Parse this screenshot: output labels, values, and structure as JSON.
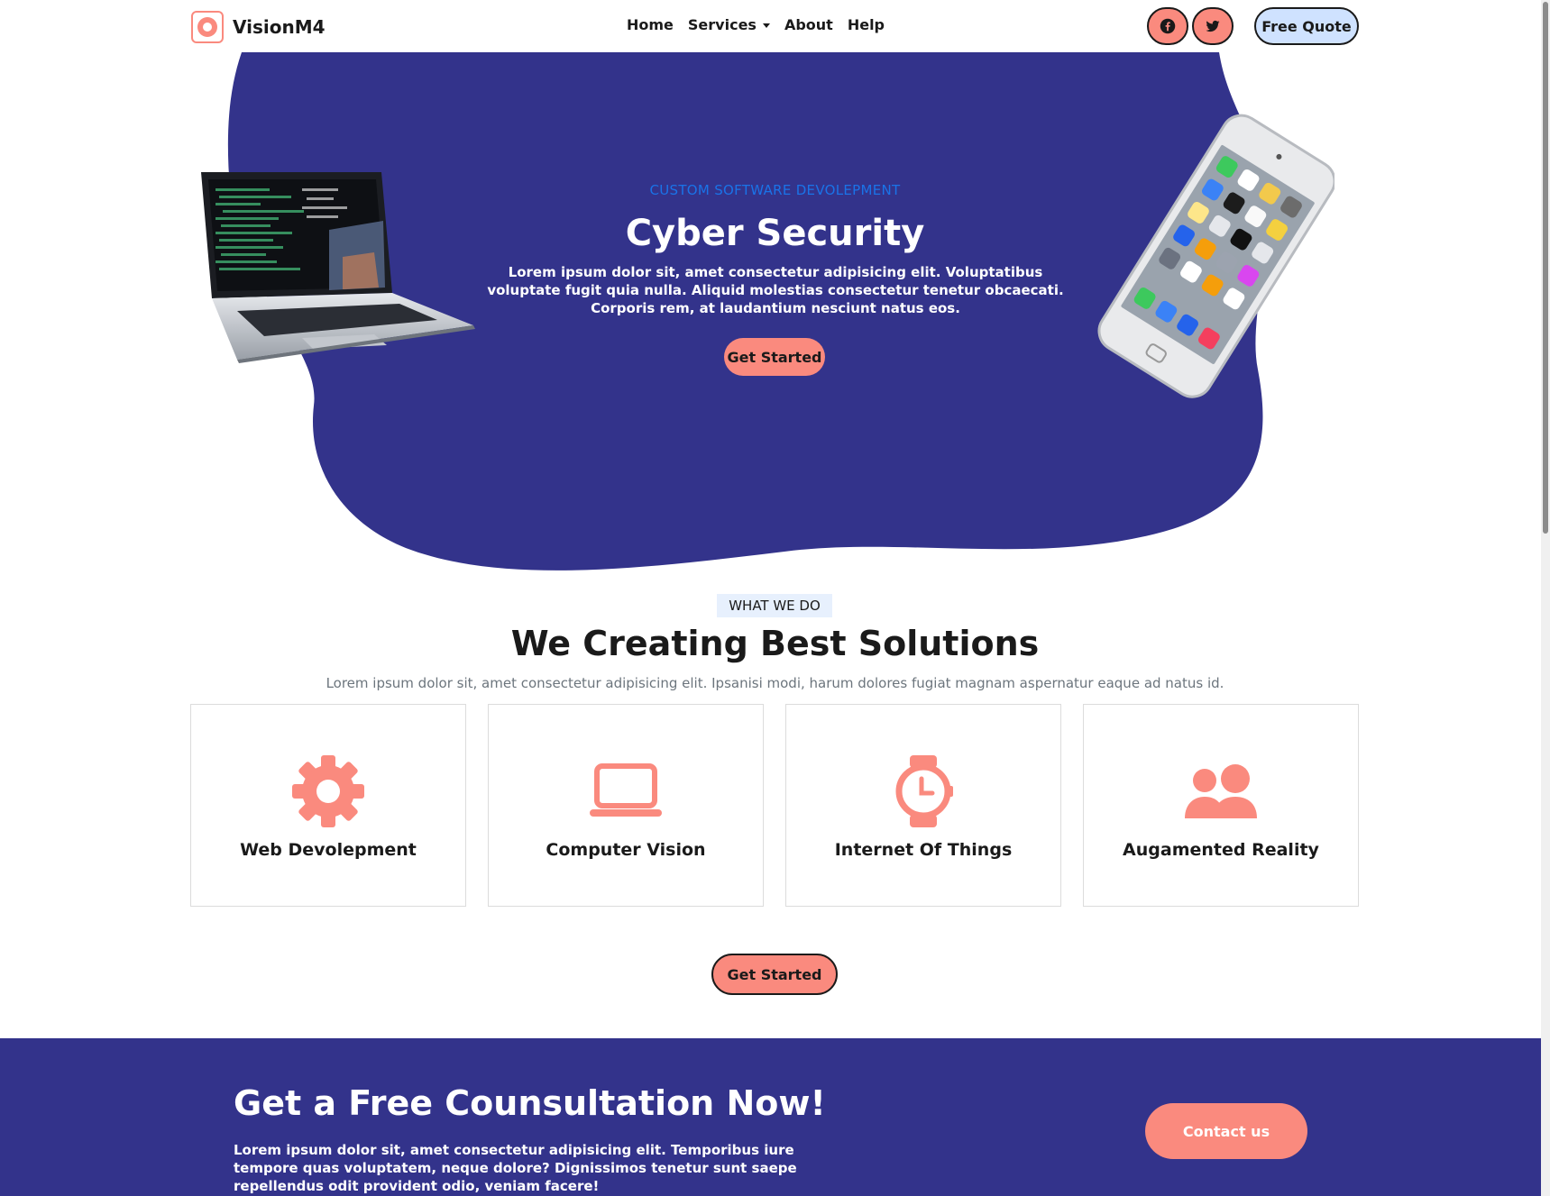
{
  "brand": {
    "name": "VisionM4"
  },
  "nav": {
    "home": "Home",
    "services": "Services",
    "about": "About",
    "help": "Help",
    "quote": "Free Quote"
  },
  "hero": {
    "subtitle": "CUSTOM SOFTWARE DEVOLEPMENT",
    "title": "Cyber Security",
    "text": "Lorem ipsum dolor sit, amet consectetur adipisicing elit. Voluptatibus voluptate fugit quia nulla. Aliquid molestias consectetur tenetur obcaecati. Corporis rem, at laudantium nesciunt natus eos.",
    "button": "Get Started"
  },
  "services_section": {
    "badge": "WHAT WE DO",
    "title": "We Creating Best Solutions",
    "subtitle": "Lorem ipsum dolor sit, amet consectetur adipisicing elit. Ipsanisi modi, harum dolores fugiat magnam aspernatur eaque ad natus id.",
    "cards": [
      {
        "label": "Web Devolepment",
        "icon": "gear-icon"
      },
      {
        "label": "Computer Vision",
        "icon": "laptop-icon"
      },
      {
        "label": "Internet Of Things",
        "icon": "smartwatch-icon"
      },
      {
        "label": "Augamented Reality",
        "icon": "users-icon"
      }
    ],
    "button": "Get Started"
  },
  "consultation": {
    "title": "Get a Free Counsultation Now!",
    "text": "Lorem ipsum dolor sit, amet consectetur adipisicing elit. Temporibus iure tempore quas voluptatem, neque dolore? Dignissimos tenetur sunt saepe repellendus odit provident odio, veniam facere!",
    "button": "Contact us"
  },
  "colors": {
    "accent": "#fa8a7e",
    "hero_blob": "#33338b",
    "quote_bg": "#cfe2ff",
    "link_blue": "#1a73e8"
  }
}
